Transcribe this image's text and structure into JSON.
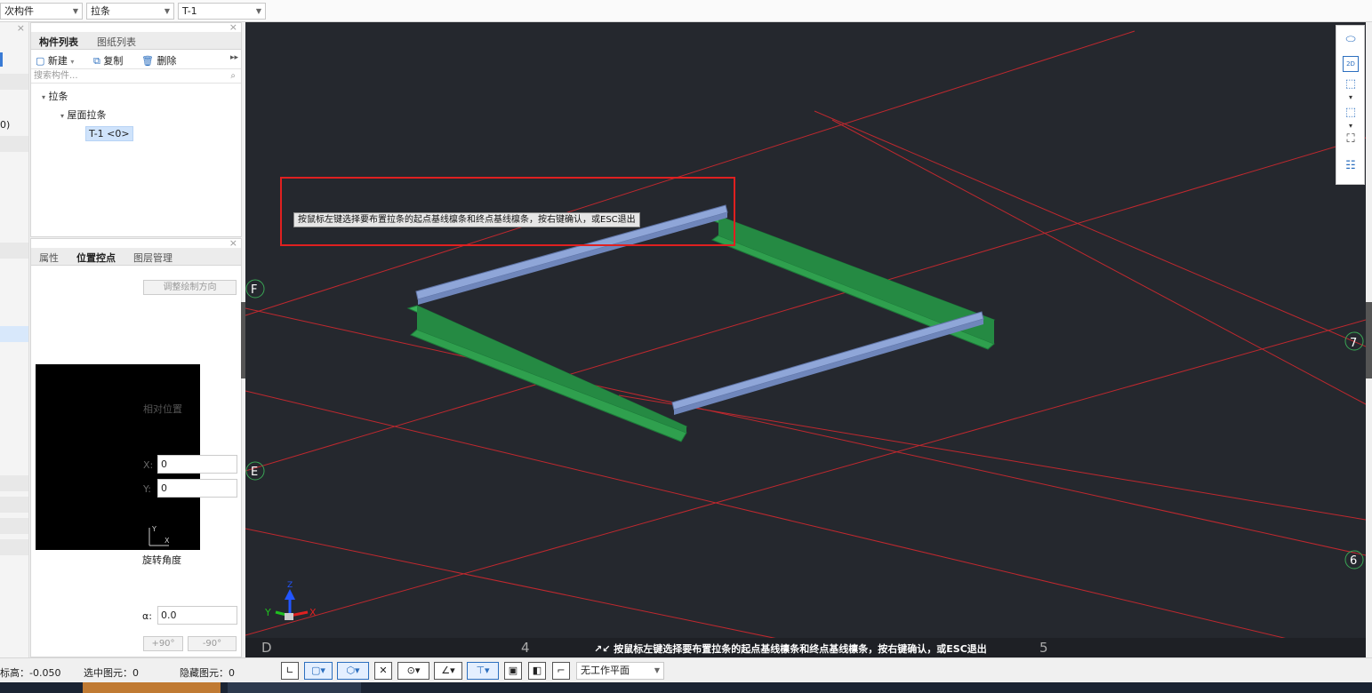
{
  "toolbar": {
    "combo1": "次构件",
    "combo2": "拉条",
    "combo3": "T-1"
  },
  "component_panel": {
    "tabs": [
      "构件列表",
      "图纸列表"
    ],
    "new_label": "新建",
    "copy_label": "复制",
    "delete_label": "删除",
    "search_placeholder": "搜索构件...",
    "tree": {
      "root": "拉条",
      "child": "屋面拉条",
      "leaf": "T-1 <0>"
    }
  },
  "position_panel": {
    "tabs": [
      "属性",
      "位置控点",
      "图层管理"
    ],
    "adjust_button": "调整绘制方向",
    "relative_position": "相对位置",
    "x_label": "X:",
    "x_value": "0",
    "y_label": "Y:",
    "y_value": "0",
    "rotation_label": "旋转角度",
    "alpha_label": "α:",
    "alpha_value": "0.0",
    "plus90": "+90°",
    "minus90": "-90°"
  },
  "left_strip": {
    "item": "0)"
  },
  "viewport": {
    "tooltip": "按鼠标左键选择要布置拉条的起点基线檩条和终点基线檩条，按右键确认，或ESC退出",
    "hint": "按鼠标左键选择要布置拉条的起点基线檩条和终点基线檩条，按右键确认，或ESC退出",
    "axis_labels": {
      "F": "F",
      "E": "E",
      "seven": "7",
      "six": "6",
      "D": "D",
      "four": "4",
      "five": "5"
    },
    "gizmo": {
      "x": "X",
      "y": "Y",
      "z": "Z"
    }
  },
  "right_tools": {
    "twod": "2D"
  },
  "status": {
    "elevation": "标高：-0.050",
    "selected": "选中图元：0",
    "hidden": "隐藏图元：0",
    "workplane": "无工作平面"
  },
  "colors": {
    "viewport_bg": "#25282e",
    "grid_line": "#c0282e",
    "purlin_green": "#2fa04e",
    "tie_blue": "#8fa6d8",
    "highlight_red": "#e02020"
  }
}
